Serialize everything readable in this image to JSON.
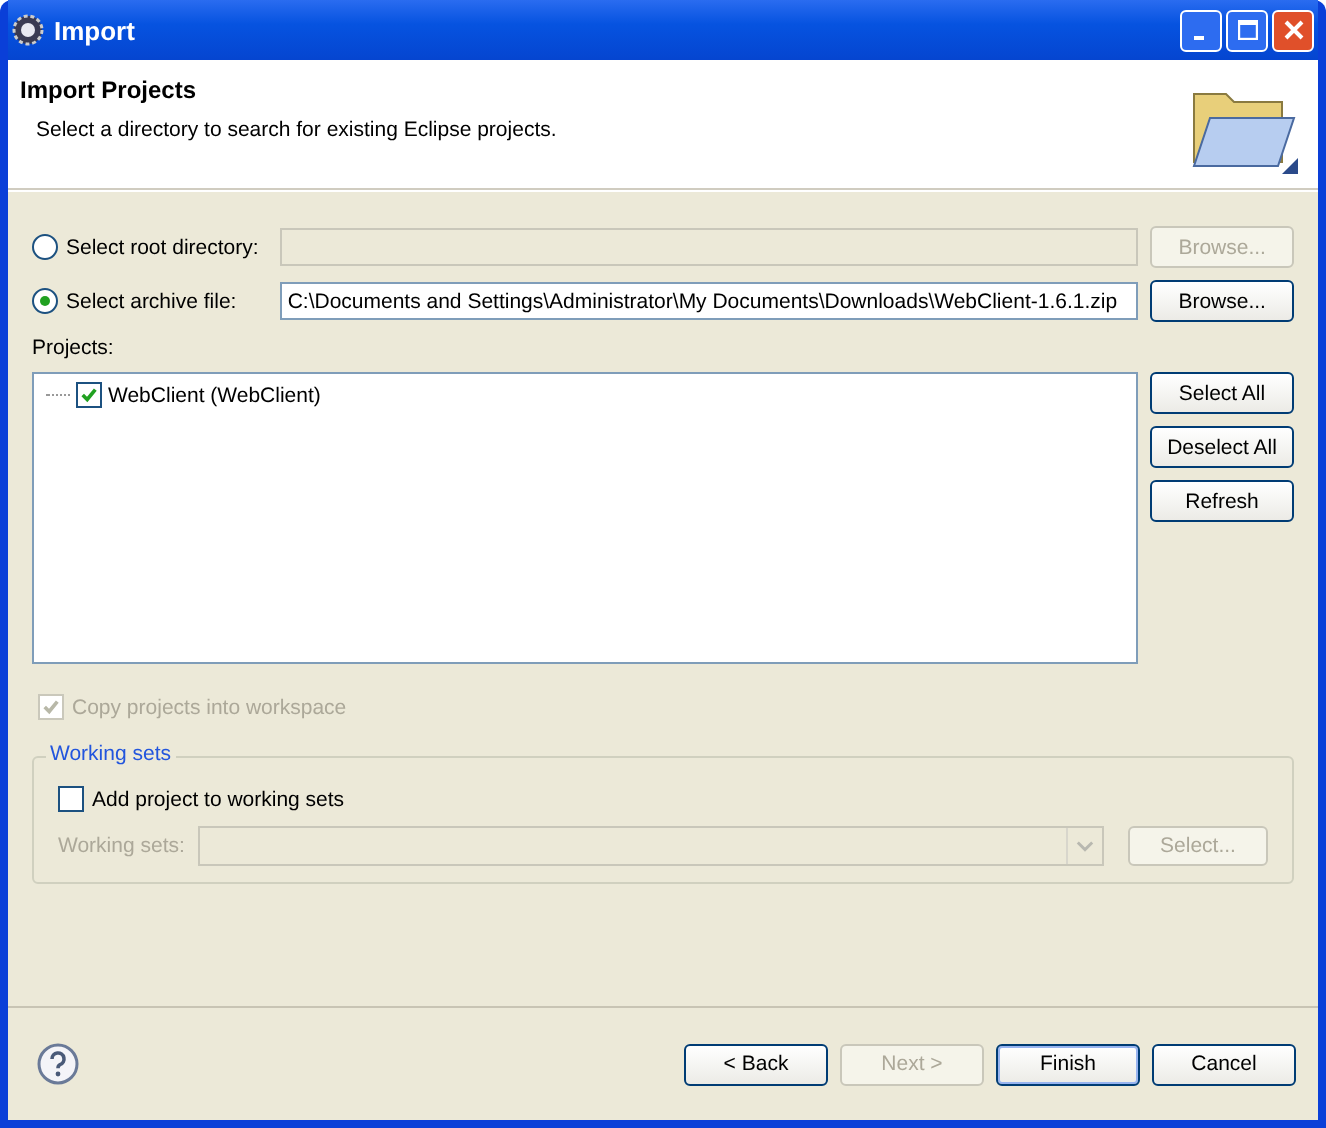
{
  "window": {
    "title": "Import"
  },
  "header": {
    "title": "Import Projects",
    "description": "Select a directory to search for existing Eclipse projects."
  },
  "sources": [
    {
      "label": "Select root directory:",
      "selected": false,
      "browse": {
        "label": "Browse...",
        "disabled": true
      }
    },
    {
      "label": "Select archive file:",
      "selected": true,
      "value": "C:\\Documents and Settings\\Administrator\\My Documents\\Downloads\\WebClient-1.6.1.zip",
      "browse": {
        "label": "Browse...",
        "disabled": false
      }
    }
  ],
  "projects": {
    "label": "Projects:",
    "items": [
      {
        "label": "WebClient (WebClient)",
        "checked": true
      }
    ],
    "buttons": [
      {
        "label": "Select All",
        "disabled": false
      },
      {
        "label": "Deselect All",
        "disabled": false
      },
      {
        "label": "Refresh",
        "disabled": false
      }
    ]
  },
  "copy_option": {
    "label": "Copy projects into workspace",
    "checked": true,
    "disabled": true
  },
  "working_sets": {
    "title": "Working sets",
    "add_option": {
      "label": "Add project to working sets",
      "checked": false
    },
    "field_label": "Working sets:",
    "disabled": true,
    "select_button": {
      "label": "Select...",
      "disabled": true
    }
  },
  "footer_buttons": [
    {
      "label": "< Back",
      "disabled": false,
      "default": false
    },
    {
      "label": "Next >",
      "disabled": true,
      "default": false
    },
    {
      "label": "Finish",
      "disabled": false,
      "default": true
    },
    {
      "label": "Cancel",
      "disabled": false,
      "default": false
    }
  ]
}
